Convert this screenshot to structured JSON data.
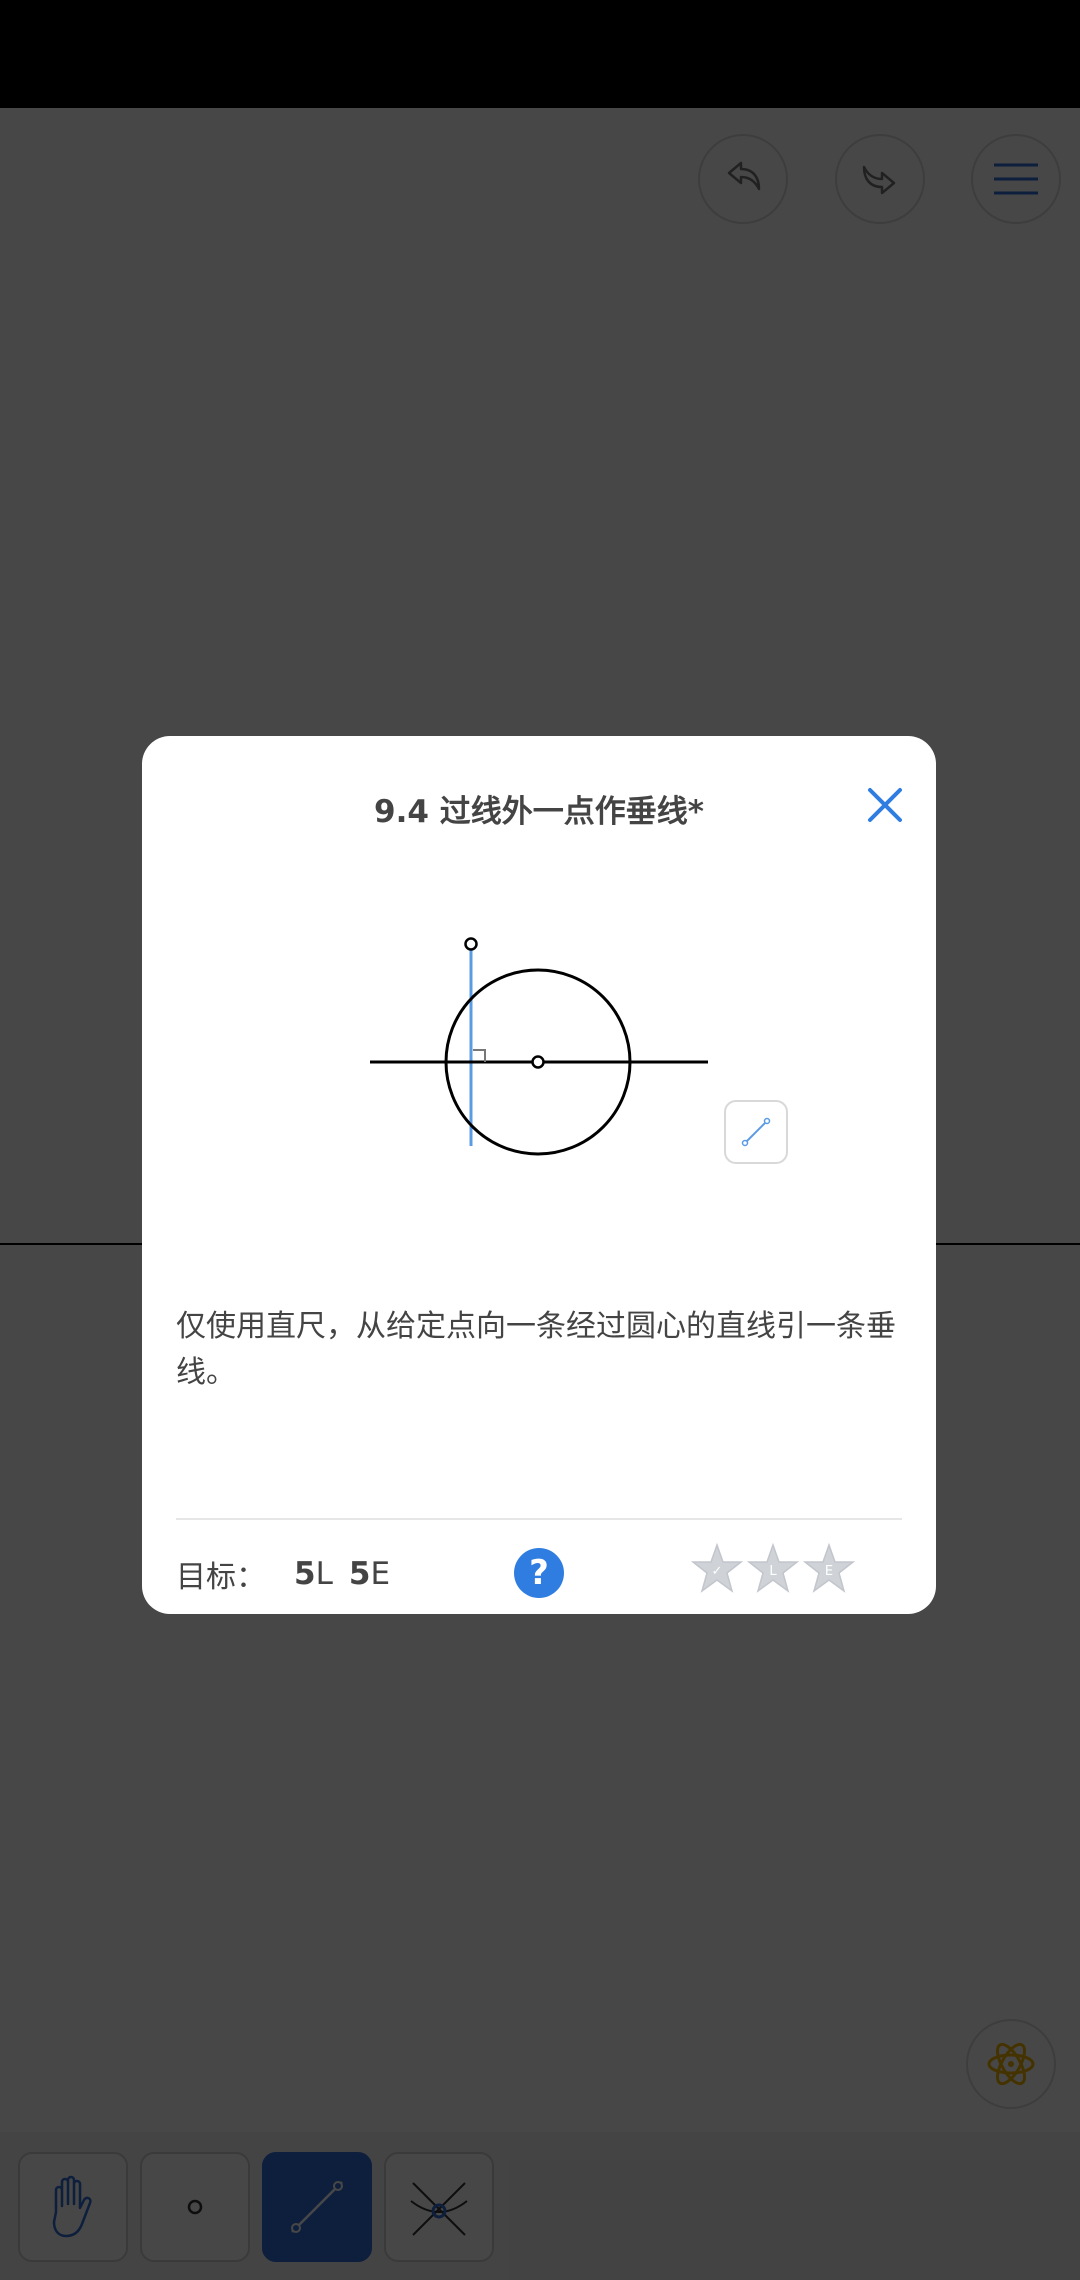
{
  "dialog": {
    "title": "9.4 过线外一点作垂线*",
    "description": "仅使用直尺，从给定点向一条经过圆心的直线引一条垂线。",
    "goal_label": "目标：",
    "goal_l_number": "5",
    "goal_l_letter": "L",
    "goal_e_number": "5",
    "goal_e_letter": "E",
    "help_symbol": "?",
    "star_labels": [
      "✓",
      "L",
      "E"
    ],
    "accent_color": "#2f7de1"
  },
  "icons": {
    "undo": "undo-icon",
    "redo": "redo-icon",
    "menu": "menu-icon",
    "close": "close-icon",
    "atom": "atom-icon",
    "hand": "hand-icon",
    "point": "point-icon",
    "line": "line-icon",
    "intersect": "intersect-icon"
  },
  "toolbar": {
    "active_tool": "line"
  }
}
